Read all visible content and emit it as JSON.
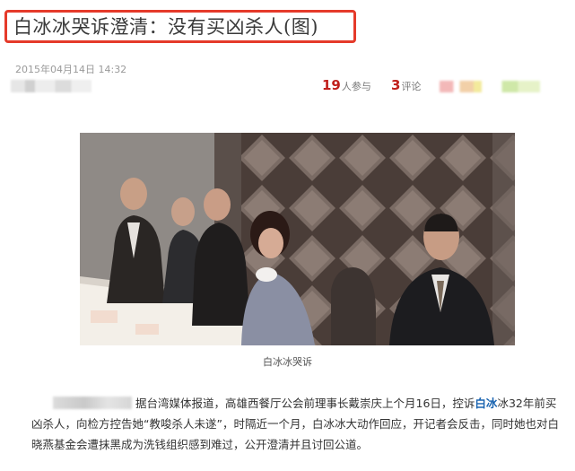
{
  "article": {
    "title": "白冰冰哭诉澄清：没有买凶杀人(图)",
    "date": "2015年04月14日  14:32",
    "participants_count": "19",
    "participants_label": "人参与",
    "comments_count": "3",
    "comments_label": "评论",
    "photo_caption": "白冰冰哭诉",
    "body_part1": "据台湾媒体报道，高雄西餐厅公会前理事长戴崇庆上个月16日，控诉",
    "body_highlight": "白冰",
    "body_part2": "冰32年前买凶杀人，向检方控告她“教唆杀人未遂”，时隔近一个月，白冰冰大动作回应，开记者会反击，同时她也对白晓燕基金会遭抹黑成为洗钱组织感到难过，公开澄清并且讨回公道。"
  },
  "colors": {
    "title_border": "#e53a2a",
    "count_red": "#c0201c",
    "highlight_blue": "#1a64b0"
  }
}
